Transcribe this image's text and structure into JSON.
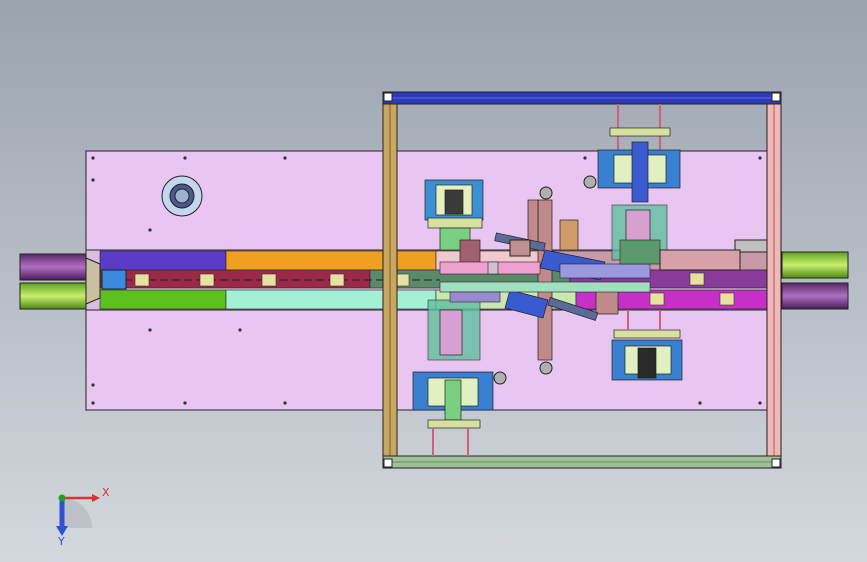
{
  "viewport": {
    "background_top": "#9aa3ae",
    "background_bottom": "#d2d6dc",
    "plate_color": "#e8c4f0",
    "frame_color": "#b89a5a",
    "top_beam_color": "#2a38b8",
    "bottom_beam_color": "#9ab890"
  },
  "triad": {
    "x_label": "X",
    "y_label": "Y",
    "x_color": "#e03030",
    "y_color": "#20a020",
    "z_color": "#3050d0"
  },
  "conveyor": {
    "segments_top": [
      "#5a3cc8",
      "#f0a020",
      "#a83050",
      "#c04060",
      "#b0e0e0",
      "#c890a0",
      "#7a2a9a"
    ],
    "segments_bottom": [
      "#60c020",
      "#a0f0d0",
      "#d0e8b0",
      "#c030c0"
    ],
    "rollers_left": [
      "#7a3a8a",
      "#90d040"
    ],
    "rollers_right": [
      "#90d040",
      "#7a3a8a"
    ]
  }
}
